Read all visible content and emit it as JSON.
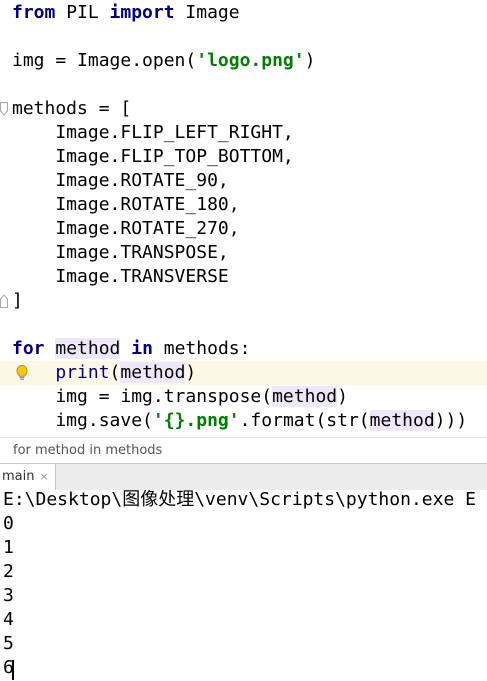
{
  "editor": {
    "lines": [
      {
        "parts": [
          [
            "kw",
            "from"
          ],
          [
            "p",
            " PIL "
          ],
          [
            "kw",
            "import"
          ],
          [
            "p",
            " Image"
          ]
        ]
      },
      {
        "parts": []
      },
      {
        "parts": [
          [
            "p",
            "img = Image.open("
          ],
          [
            "str",
            "'logo.png'"
          ],
          [
            "p",
            ")"
          ]
        ]
      },
      {
        "parts": []
      },
      {
        "parts": [
          [
            "p",
            "methods = ["
          ]
        ]
      },
      {
        "parts": [
          [
            "p",
            "    Image.FLIP_LEFT_RIGHT,"
          ]
        ]
      },
      {
        "parts": [
          [
            "p",
            "    Image.FLIP_TOP_BOTTOM,"
          ]
        ]
      },
      {
        "parts": [
          [
            "p",
            "    Image.ROTATE_90,"
          ]
        ]
      },
      {
        "parts": [
          [
            "p",
            "    Image.ROTATE_180,"
          ]
        ]
      },
      {
        "parts": [
          [
            "p",
            "    Image.ROTATE_270,"
          ]
        ]
      },
      {
        "parts": [
          [
            "p",
            "    Image.TRANSPOSE,"
          ]
        ]
      },
      {
        "parts": [
          [
            "p",
            "    Image.TRANSVERSE"
          ]
        ]
      },
      {
        "parts": [
          [
            "p",
            "]"
          ]
        ]
      },
      {
        "parts": []
      },
      {
        "parts": [
          [
            "kw",
            "for"
          ],
          [
            "p",
            " "
          ],
          [
            "hl",
            "method"
          ],
          [
            "p",
            " "
          ],
          [
            "kw",
            "in"
          ],
          [
            "p",
            " methods:"
          ]
        ]
      },
      {
        "parts": [
          [
            "p",
            "    "
          ],
          [
            "builtin",
            "print"
          ],
          [
            "p",
            "("
          ],
          [
            "hl",
            "method"
          ],
          [
            "p",
            ")"
          ]
        ]
      },
      {
        "parts": [
          [
            "p",
            "    img = img.transpose("
          ],
          [
            "hl",
            "method"
          ],
          [
            "p",
            ")"
          ]
        ]
      },
      {
        "parts": [
          [
            "p",
            "    img.save("
          ],
          [
            "str",
            "'{}.png'"
          ],
          [
            "p",
            ".format(str("
          ],
          [
            "hl",
            "method"
          ],
          [
            "p",
            "))"
          ],
          [
            "p",
            ")"
          ]
        ]
      }
    ]
  },
  "breadcrumb": {
    "text": "for method in methods"
  },
  "run_panel": {
    "tab_label": "main",
    "tab_close": "×",
    "console_lines": [
      "E:\\Desktop\\图像处理\\venv\\Scripts\\python.exe E",
      "0",
      "1",
      "2",
      "3",
      "4",
      "5",
      "6"
    ]
  }
}
